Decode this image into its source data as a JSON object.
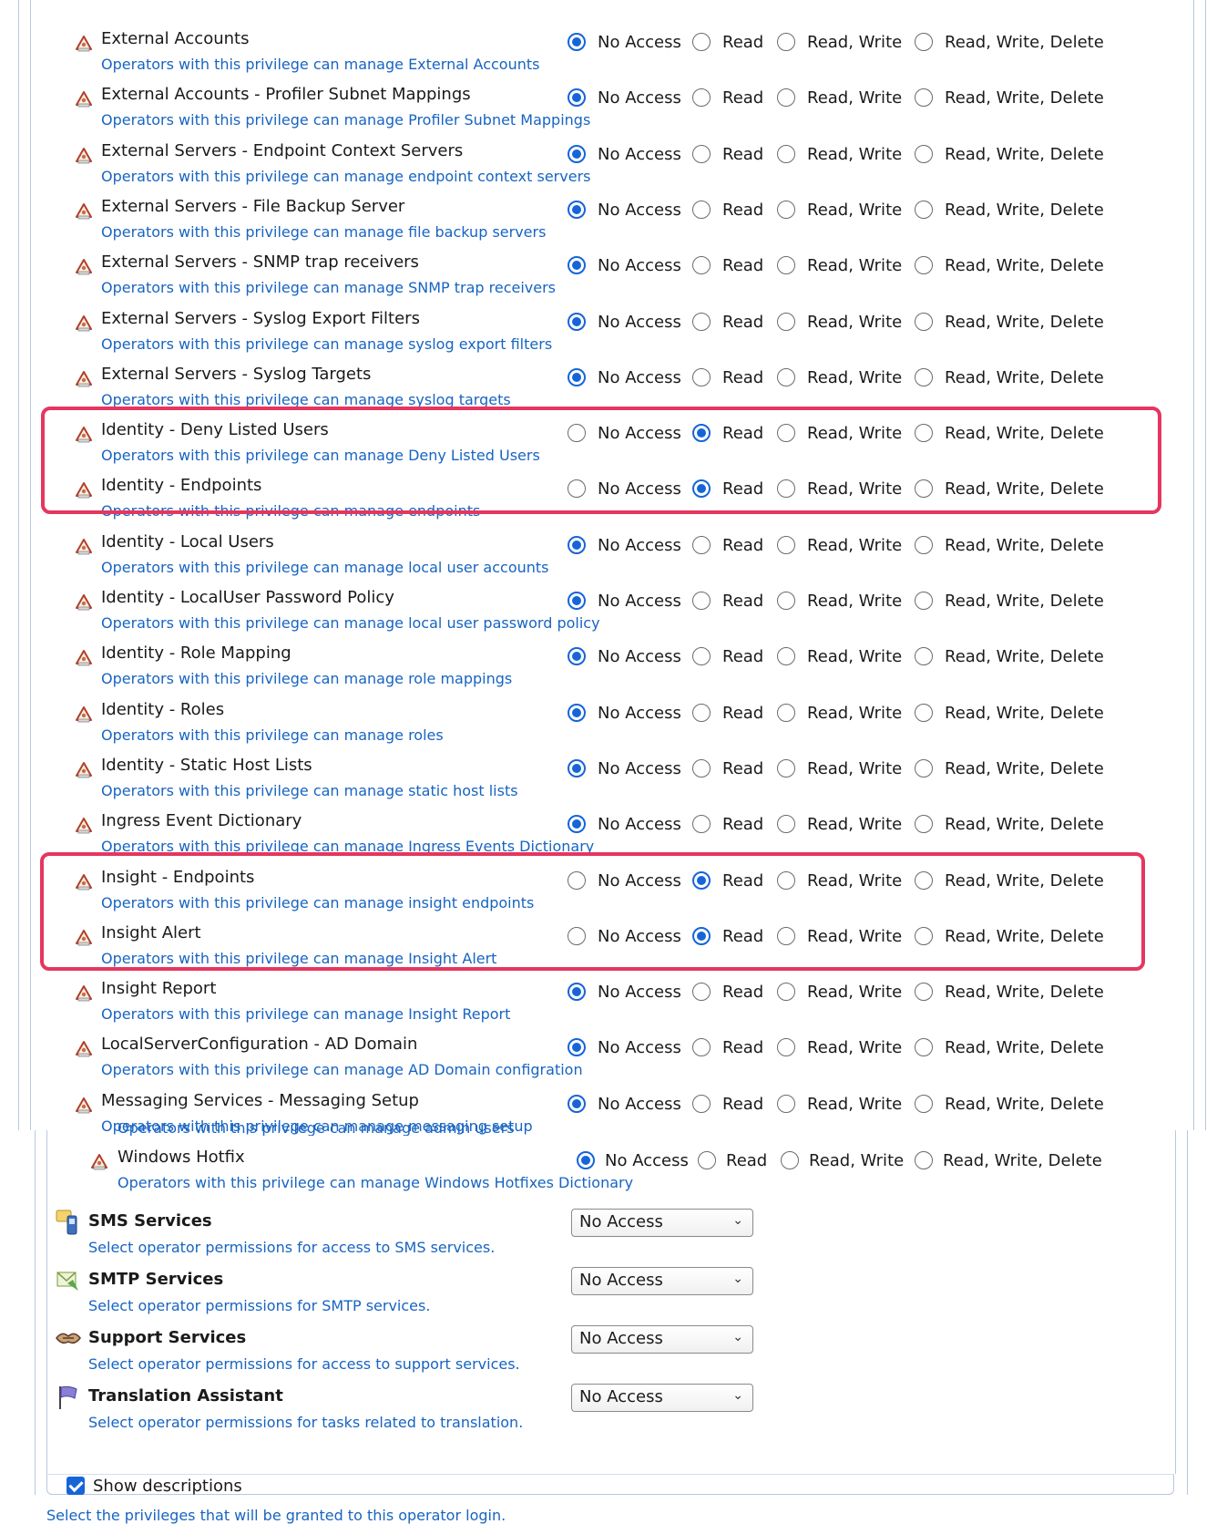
{
  "radio_options": [
    "No Access",
    "Read",
    "Read, Write",
    "Read, Write, Delete"
  ],
  "privileges": [
    {
      "title": "External Accounts",
      "desc": "Operators with this privilege can manage External Accounts",
      "selected": "No Access",
      "highlighted": false
    },
    {
      "title": "External Accounts - Profiler Subnet Mappings",
      "desc": "Operators with this privilege can manage Profiler Subnet Mappings",
      "selected": "No Access",
      "highlighted": false
    },
    {
      "title": "External Servers - Endpoint Context Servers",
      "desc": "Operators with this privilege can manage endpoint context servers",
      "selected": "No Access",
      "highlighted": false
    },
    {
      "title": "External Servers - File Backup Server",
      "desc": "Operators with this privilege can manage file backup servers",
      "selected": "No Access",
      "highlighted": false
    },
    {
      "title": "External Servers - SNMP trap receivers",
      "desc": "Operators with this privilege can manage SNMP trap receivers",
      "selected": "No Access",
      "highlighted": false
    },
    {
      "title": "External Servers - Syslog Export Filters",
      "desc": "Operators with this privilege can manage syslog export filters",
      "selected": "No Access",
      "highlighted": false
    },
    {
      "title": "External Servers - Syslog Targets",
      "desc": "Operators with this privilege can manage syslog targets",
      "selected": "No Access",
      "highlighted": false
    },
    {
      "title": "Identity - Deny Listed Users",
      "desc": "Operators with this privilege can manage Deny Listed Users",
      "selected": "Read",
      "highlighted": true
    },
    {
      "title": "Identity - Endpoints",
      "desc": "Operators with this privilege can manage endpoints",
      "selected": "Read",
      "highlighted": true
    },
    {
      "title": "Identity - Local Users",
      "desc": "Operators with this privilege can manage local user accounts",
      "selected": "No Access",
      "highlighted": false
    },
    {
      "title": "Identity - LocalUser Password Policy",
      "desc": "Operators with this privilege can manage local user password policy",
      "selected": "No Access",
      "highlighted": false
    },
    {
      "title": "Identity - Role Mapping",
      "desc": "Operators with this privilege can manage role mappings",
      "selected": "No Access",
      "highlighted": false
    },
    {
      "title": "Identity - Roles",
      "desc": "Operators with this privilege can manage roles",
      "selected": "No Access",
      "highlighted": false
    },
    {
      "title": "Identity - Static Host Lists",
      "desc": "Operators with this privilege can manage static host lists",
      "selected": "No Access",
      "highlighted": false
    },
    {
      "title": "Ingress Event Dictionary",
      "desc": "Operators with this privilege can manage Ingress Events Dictionary",
      "selected": "No Access",
      "highlighted": false
    },
    {
      "title": "Insight - Endpoints",
      "desc": "Operators with this privilege can manage insight endpoints",
      "selected": "Read",
      "highlighted": true
    },
    {
      "title": "Insight Alert",
      "desc": "Operators with this privilege can manage Insight Alert",
      "selected": "Read",
      "highlighted": true
    },
    {
      "title": "Insight Report",
      "desc": "Operators with this privilege can manage Insight Report",
      "selected": "No Access",
      "highlighted": false
    },
    {
      "title": "LocalServerConfiguration - AD Domain",
      "desc": "Operators with this privilege can manage AD Domain configration",
      "selected": "No Access",
      "highlighted": false
    },
    {
      "title": "Messaging Services - Messaging Setup",
      "desc": "Operators with this privilege can manage messaging setup",
      "selected": "No Access",
      "highlighted": false
    }
  ],
  "cut_off_text": "Operators with this privilege can manage admin users",
  "windows_hotfix": {
    "title": "Windows Hotfix",
    "desc": "Operators with this privilege can manage Windows Hotfixes Dictionary",
    "selected": "No Access"
  },
  "services": [
    {
      "title": "SMS Services",
      "desc": "Select operator permissions for access to SMS services.",
      "value": "No Access",
      "icon": "sms-icon"
    },
    {
      "title": "SMTP Services",
      "desc": "Select operator permissions for SMTP services.",
      "value": "No Access",
      "icon": "smtp-icon"
    },
    {
      "title": "Support Services",
      "desc": "Select operator permissions for access to support services.",
      "value": "No Access",
      "icon": "support-icon"
    },
    {
      "title": "Translation Assistant",
      "desc": "Select operator permissions for tasks related to translation.",
      "value": "No Access",
      "icon": "translation-icon"
    }
  ],
  "show_descriptions": {
    "label": "Show descriptions",
    "checked": true
  },
  "footer_note": "Select the privileges that will be granted to this operator login.",
  "colors": {
    "highlight": "#e5365f",
    "link": "#1764c2",
    "radio_selected": "#1665d8"
  }
}
